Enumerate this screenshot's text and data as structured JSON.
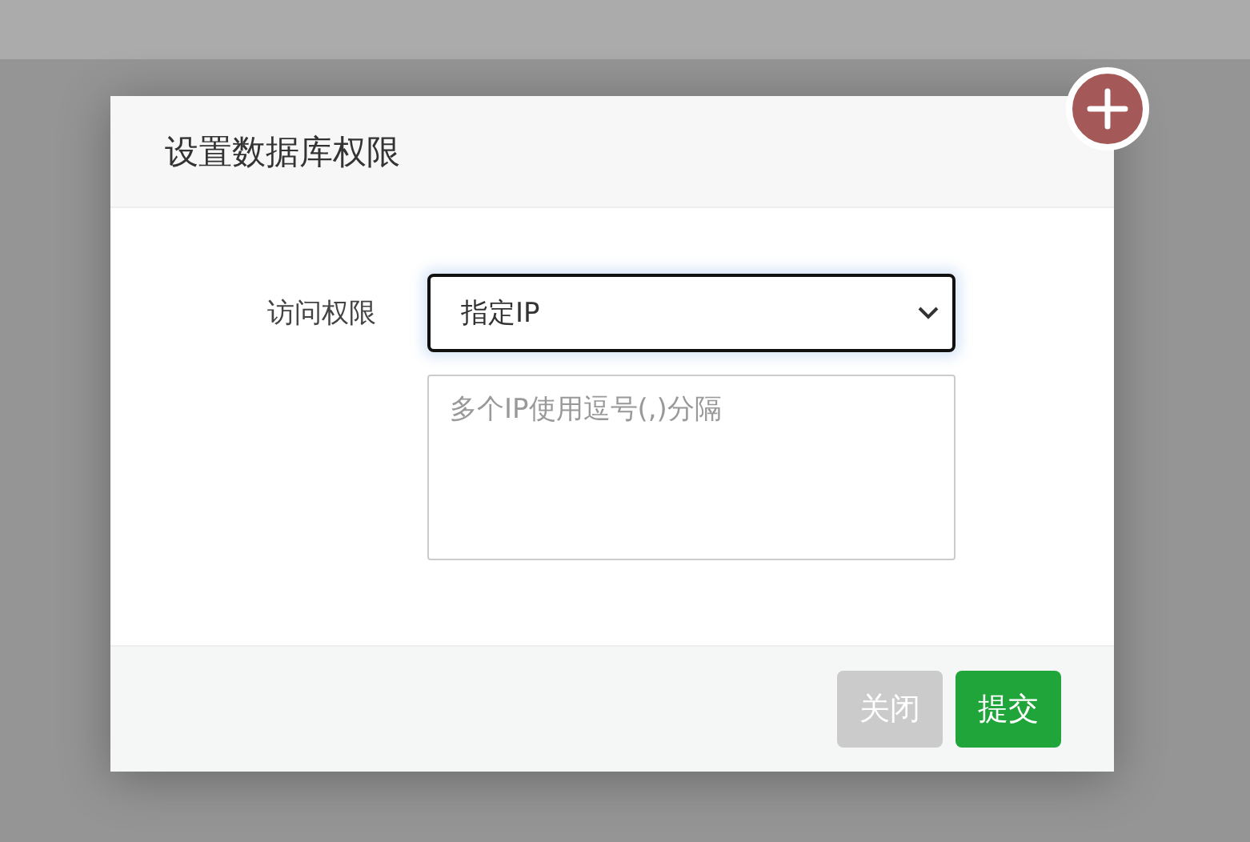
{
  "dialog": {
    "title": "设置数据库权限",
    "fields": [
      {
        "label": "访问权限",
        "value": "指定IP",
        "focused": true
      }
    ],
    "ip_list": {
      "placeholder": "多个IP使用逗号(,)分隔"
    },
    "buttons": [
      {
        "label": "关闭",
        "kind": "secondary"
      },
      {
        "label": "提交",
        "kind": "primary"
      }
    ]
  }
}
